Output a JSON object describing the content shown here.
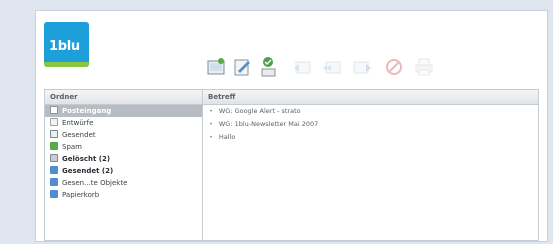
{
  "brand": {
    "logo_text": "1blu"
  },
  "toolbar": {
    "icons": [
      {
        "name": "new-mail-icon",
        "enabled": true
      },
      {
        "name": "compose-icon",
        "enabled": true
      },
      {
        "name": "fetch-mail-icon",
        "enabled": true
      },
      {
        "name": "reply-icon",
        "enabled": false
      },
      {
        "name": "reply-all-icon",
        "enabled": false
      },
      {
        "name": "forward-icon",
        "enabled": false
      },
      {
        "name": "delete-icon",
        "enabled": false
      },
      {
        "name": "print-icon",
        "enabled": false
      }
    ]
  },
  "folders": {
    "header": "Ordner",
    "items": [
      {
        "label": "Posteingang",
        "icon": "inbox-icon",
        "selected": true
      },
      {
        "label": "Entwürfe",
        "icon": "drafts-icon"
      },
      {
        "label": "Gesendet",
        "icon": "sent-icon"
      },
      {
        "label": "Spam",
        "icon": "spam-icon"
      },
      {
        "label": "Gelöscht (2)",
        "icon": "deleted-icon",
        "bold": true
      },
      {
        "label": "Gesendet (2)",
        "icon": "sent-folder-icon",
        "bold": true
      },
      {
        "label": "Gesen...te Objekte",
        "icon": "sent-items-icon"
      },
      {
        "label": "Papierkorb",
        "icon": "trash-icon"
      }
    ]
  },
  "messages": {
    "header": "Betreff",
    "items": [
      {
        "subject": "WG: Google Alert - strato"
      },
      {
        "subject": "WG: 1blu-Newsletter Mai 2007"
      },
      {
        "subject": "Hallo"
      }
    ]
  },
  "colors": {
    "accent": "#1d9fd9",
    "brand_green": "#8cc63f",
    "selected": "#b7bcc2"
  }
}
